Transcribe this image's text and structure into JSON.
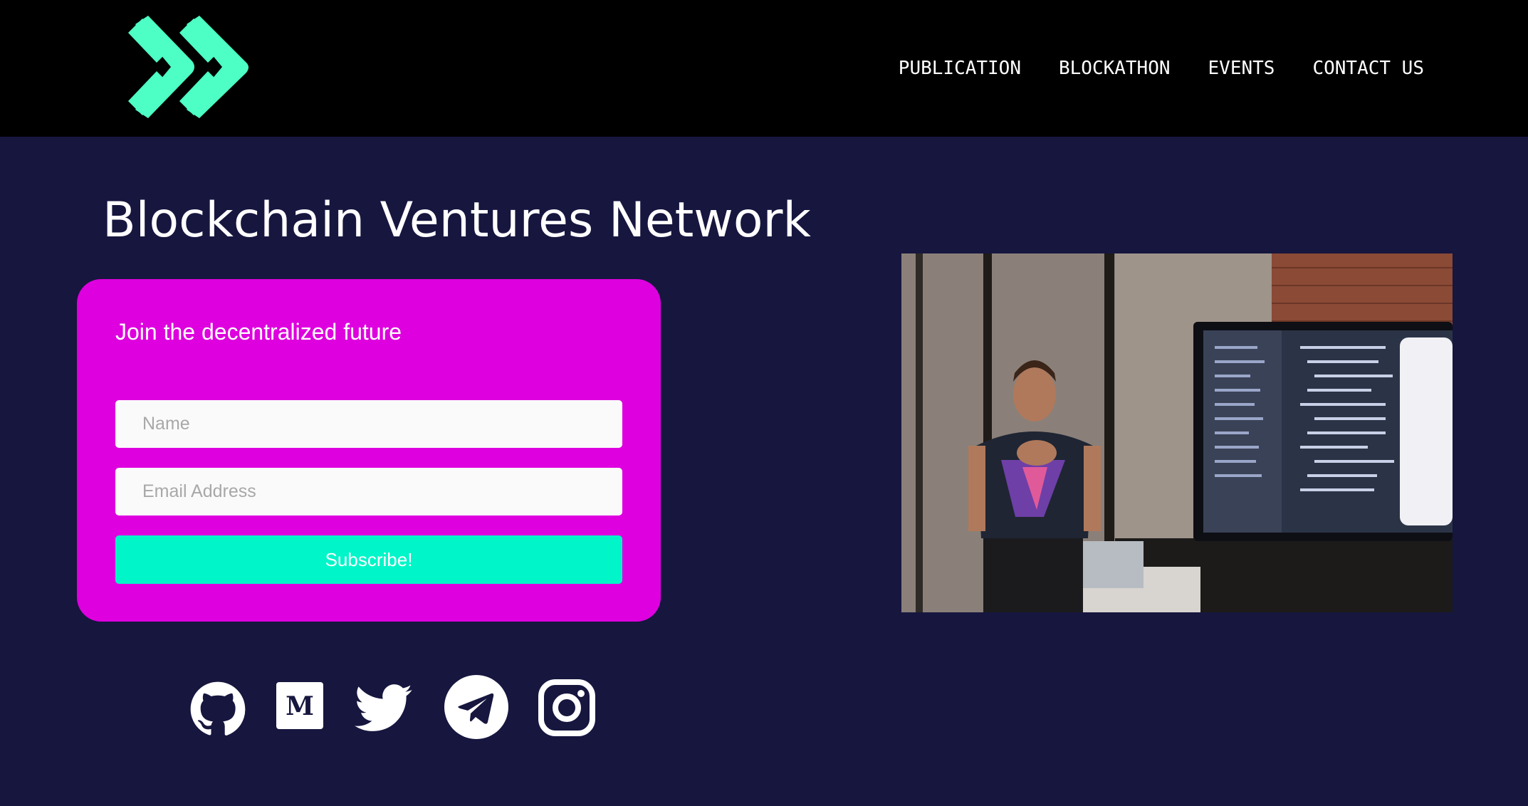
{
  "header": {
    "logo_alt": "logo",
    "brand_color": "#4dffc4",
    "nav": [
      {
        "label": "PUBLICATION"
      },
      {
        "label": "BLOCKATHON"
      },
      {
        "label": "EVENTS"
      },
      {
        "label": "CONTACT US"
      }
    ]
  },
  "main": {
    "title": "Blockchain Ventures Network",
    "signup": {
      "heading": "Join the decentralized future",
      "name_placeholder": "Name",
      "email_placeholder": "Email Address",
      "button_label": "Subscribe!",
      "card_color": "#de00de",
      "button_color": "#00f5c8"
    },
    "photo": {
      "description_icon": "photo-speaker-presentation"
    }
  },
  "social": [
    {
      "icon": "github-icon"
    },
    {
      "icon": "medium-icon"
    },
    {
      "icon": "twitter-icon"
    },
    {
      "icon": "telegram-icon"
    },
    {
      "icon": "instagram-icon"
    }
  ],
  "colors": {
    "page_bg": "#16163f",
    "header_bg": "#000000"
  }
}
